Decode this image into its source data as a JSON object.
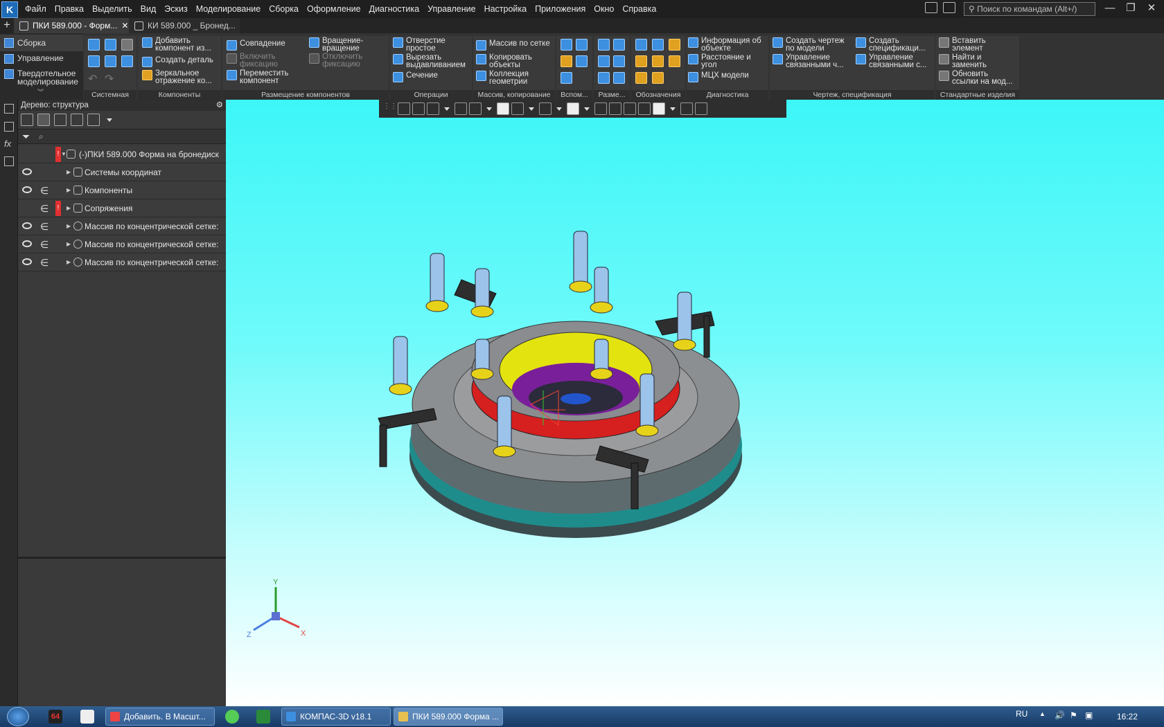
{
  "menubar": {
    "items": [
      "Файл",
      "Правка",
      "Выделить",
      "Вид",
      "Эскиз",
      "Моделирование",
      "Сборка",
      "Оформление",
      "Диагностика",
      "Управление",
      "Настройка",
      "Приложения",
      "Окно",
      "Справка"
    ],
    "search_placeholder": "Поиск по командам (Alt+/)"
  },
  "tabs": [
    {
      "label": "ПКИ 589.000 - Форм..."
    },
    {
      "label": "КИ 589.000 _ Бронед..."
    }
  ],
  "ribbon": {
    "left_items": [
      "Сборка",
      "Управление",
      "Твердотельное моделирование"
    ],
    "groups": {
      "system": "Системная",
      "components": "Компоненты",
      "placement": "Размещение компонентов",
      "operations": "Операции",
      "pattern": "Массив, копирование",
      "aux": "Вспом...",
      "dims": "Разме...",
      "notation": "Обозначения",
      "diagnostics": "Диагностика",
      "drawing": "Чертеж, спецификация",
      "standard": "Стандартные изделия"
    },
    "buttons": {
      "add_component": "Добавить компонент из...",
      "create_part": "Создать деталь",
      "mirror": "Зеркальное отражение ко...",
      "coincidence": "Совпадение",
      "rotation": "Вращение-вращение",
      "fix_on": "Включить фиксацию",
      "fix_off": "Отключить фиксацию",
      "move_component": "Переместить компонент",
      "simple_hole": "Отверстие простое",
      "extrude_cut": "Вырезать выдавливанием",
      "section": "Сечение",
      "grid_pattern": "Массив по сетке",
      "copy_objects": "Копировать объекты",
      "geometry_collection": "Коллекция геометрии",
      "object_info": "Информация об объекте",
      "distance_angle": "Расстояние и угол",
      "mass_props": "МЦХ модели",
      "create_drawing": "Создать чертеж по модели",
      "manage_linked1": "Управление связанными ч...",
      "create_spec": "Создать спецификаци...",
      "manage_linked2": "Управление связанными с...",
      "insert_element": "Вставить элемент",
      "find_replace": "Найти и заменить",
      "update_links": "Обновить ссылки на мод..."
    }
  },
  "tree": {
    "title": "Дерево: структура",
    "root": "(-)ПКИ 589.000 Форма на бронедиск",
    "items": [
      {
        "label": "Системы координат",
        "eye": true,
        "incl": false,
        "err": false
      },
      {
        "label": "Компоненты",
        "eye": true,
        "incl": true,
        "err": false
      },
      {
        "label": "Сопряжения",
        "eye": false,
        "incl": true,
        "err": true
      },
      {
        "label": "Массив по концентрической сетке:",
        "eye": true,
        "incl": true,
        "err": false
      },
      {
        "label": "Массив по концентрической сетке:",
        "eye": true,
        "incl": true,
        "err": false
      },
      {
        "label": "Массив по концентрической сетке:",
        "eye": true,
        "incl": true,
        "err": false
      }
    ],
    "err_mark": "!"
  },
  "triad": {
    "x": "X",
    "y": "Y",
    "z": "Z"
  },
  "taskbar": {
    "tasks": [
      "Добавить. В Масшт...",
      "КОМПАС-3D v18.1",
      "ПКИ 589.000 Форма ..."
    ],
    "badge": "64",
    "lang": "RU",
    "time": "16:22"
  },
  "colors": {
    "viewport_top": "#3df6f8",
    "viewport_bottom": "#ffffff",
    "error": "#e03030",
    "accent": "#3d8fe0"
  }
}
